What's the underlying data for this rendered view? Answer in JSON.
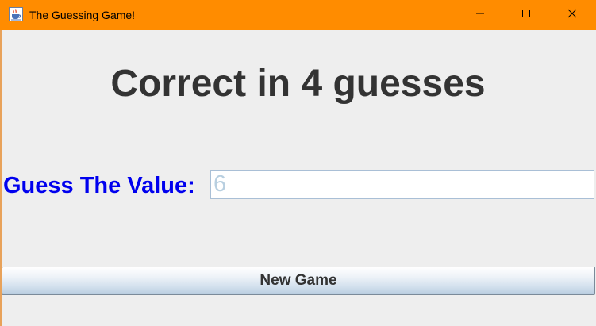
{
  "window": {
    "title": "The Guessing Game!",
    "icon": "java-cup-icon",
    "accent_color": "#ff8c00",
    "controls": [
      "minimize-icon",
      "maximize-icon",
      "close-icon"
    ]
  },
  "main": {
    "status_text": "Correct in 4 guesses",
    "guess_label": "Guess The Value:",
    "guess_value": "6",
    "new_game_label": "New Game"
  }
}
